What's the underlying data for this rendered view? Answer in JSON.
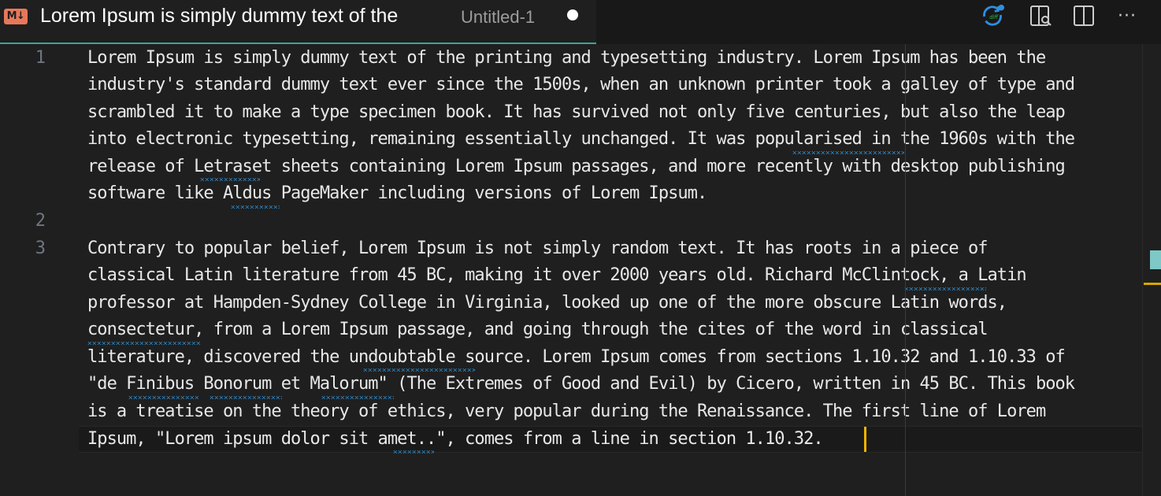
{
  "tab": {
    "icon_label": "M↓",
    "title": "Lorem Ipsum is simply dummy text of the",
    "subtitle": "Untitled-1",
    "dirty": true
  },
  "actions": [
    {
      "name": "open-changes-icon",
      "label": "diff"
    },
    {
      "name": "open-preview-to-side-icon",
      "label": ""
    },
    {
      "name": "split-editor-icon",
      "label": ""
    },
    {
      "name": "more-actions-icon",
      "label": "···"
    }
  ],
  "editor": {
    "line_numbers": [
      "1",
      "2",
      "3"
    ],
    "lines": [
      "Lorem Ipsum is simply dummy text of the printing and typesetting industry. Lorem Ipsum has been the",
      "industry's standard dummy text ever since the 1500s, when an unknown printer took a galley of type and",
      "scrambled it to make a type specimen book. It has survived not only five centuries, but also the leap",
      "into electronic typesetting, remaining essentially unchanged. It was popularised in the 1960s with the",
      "release of Letraset sheets containing Lorem Ipsum passages, and more recently with desktop publishing",
      "software like Aldus PageMaker including versions of Lorem Ipsum.",
      "",
      "Contrary to popular belief, Lorem Ipsum is not simply random text. It has roots in a piece of",
      "classical Latin literature from 45 BC, making it over 2000 years old. Richard McClintock, a Latin",
      "professor at Hampden-Sydney College in Virginia, looked up one of the more obscure Latin words,",
      "consectetur, from a Lorem Ipsum passage, and going through the cites of the word in classical",
      "literature, discovered the undoubtable source. Lorem Ipsum comes from sections 1.10.32 and 1.10.33 of",
      "\"de Finibus Bonorum et Malorum\" (The Extremes of Good and Evil) by Cicero, written in 45 BC. This book",
      "is a treatise on the theory of ethics, very popular during the Renaissance. The first line of Lorem",
      "Ipsum, \"Lorem ipsum dolor sit amet..\", comes from a line in section 1.10.32."
    ]
  },
  "colors": {
    "tab_accent": "#3aa59a",
    "cursor": "#f0b400",
    "spell_squiggle": "#2e8bcc",
    "markdown_icon": "#e8775a"
  }
}
